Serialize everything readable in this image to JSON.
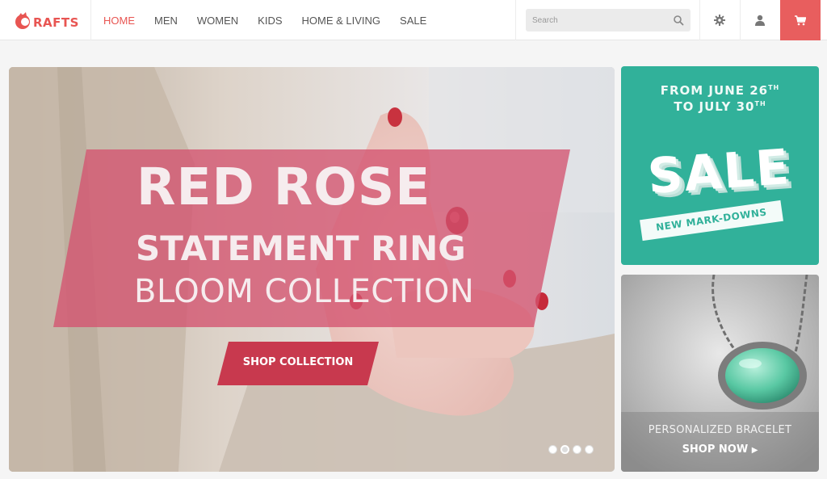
{
  "brand": {
    "name": "RAFTS",
    "accent": "#e85552"
  },
  "nav": {
    "items": [
      {
        "label": "HOME",
        "active": true
      },
      {
        "label": "MEN",
        "active": false
      },
      {
        "label": "WOMEN",
        "active": false
      },
      {
        "label": "KIDS",
        "active": false
      },
      {
        "label": "HOME & LIVING",
        "active": false
      },
      {
        "label": "SALE",
        "active": false
      }
    ]
  },
  "search": {
    "placeholder": "Search",
    "value": ""
  },
  "header_icons": [
    "gear-icon",
    "user-icon",
    "cart-icon"
  ],
  "hero": {
    "line1": "RED ROSE",
    "line2": "STATEMENT RING",
    "line3": "BLOOM COLLECTION",
    "cta": "SHOP COLLECTION",
    "slides": 4,
    "active_slide": 2,
    "band_color": "#d4536f",
    "cta_color": "#c8394e"
  },
  "sale_panel": {
    "date_line1": "FROM JUNE 26",
    "date_line1_suffix": "TH",
    "date_line2": "TO JULY 30",
    "date_line2_suffix": "TH",
    "headline": "SALE",
    "tag": "NEW MARK-DOWNS",
    "color": "#31b19a"
  },
  "bracelet_panel": {
    "title": "PERSONALIZED BRACELET",
    "cta": "SHOP NOW"
  }
}
